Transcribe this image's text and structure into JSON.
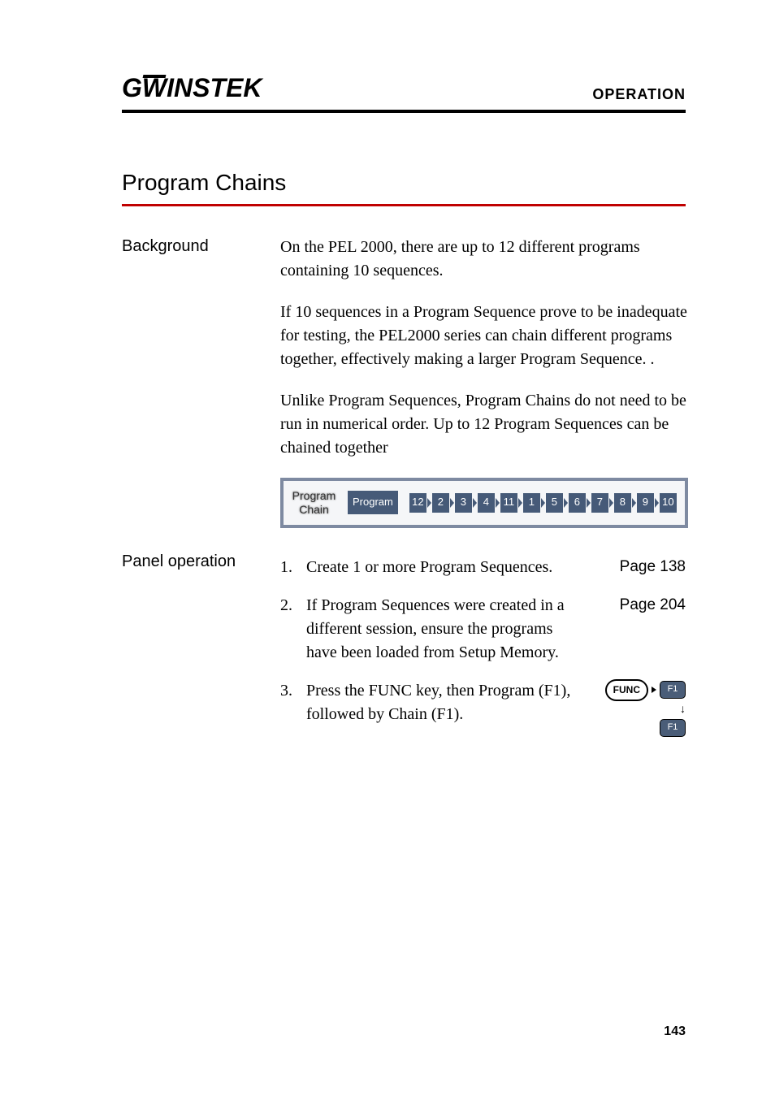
{
  "header": {
    "brand_prefix": "G",
    "brand_u": "W",
    "brand_suffix": "INSTEK",
    "section": "OPERATION"
  },
  "title": "Program Chains",
  "background": {
    "label": "Background",
    "p1": "On the PEL 2000, there are up to 12 different programs containing 10 sequences.",
    "p2": "If 10 sequences in a Program Sequence prove to be inadequate for testing, the PEL2000 series can chain different programs together, effectively making a larger Program Sequence. .",
    "p3": "Unlike Program Sequences, Program Chains do not need to be run in numerical order. Up to 12 Program Sequences can be chained together"
  },
  "chart_data": {
    "type": "table",
    "title": "Program Chain sequence",
    "label_line1": "Program",
    "label_line2": "Chain",
    "box": "Program",
    "sequence": [
      "12",
      "2",
      "3",
      "4",
      "11",
      "1",
      "5",
      "6",
      "7",
      "8",
      "9",
      "10"
    ]
  },
  "panel": {
    "label": "Panel operation",
    "steps": [
      {
        "num": "1.",
        "text": "Create 1 or more Program Sequences.",
        "page": "Page  138"
      },
      {
        "num": "2.",
        "text": "If Program Sequences were created in a different session, ensure the programs have been loaded from Setup Memory.",
        "page": "Page 204"
      },
      {
        "num": "3.",
        "text": "Press the FUNC key, then Program (F1), followed by Chain (F1).",
        "func": "FUNC",
        "f1": "F1"
      }
    ]
  },
  "page_number": "143"
}
